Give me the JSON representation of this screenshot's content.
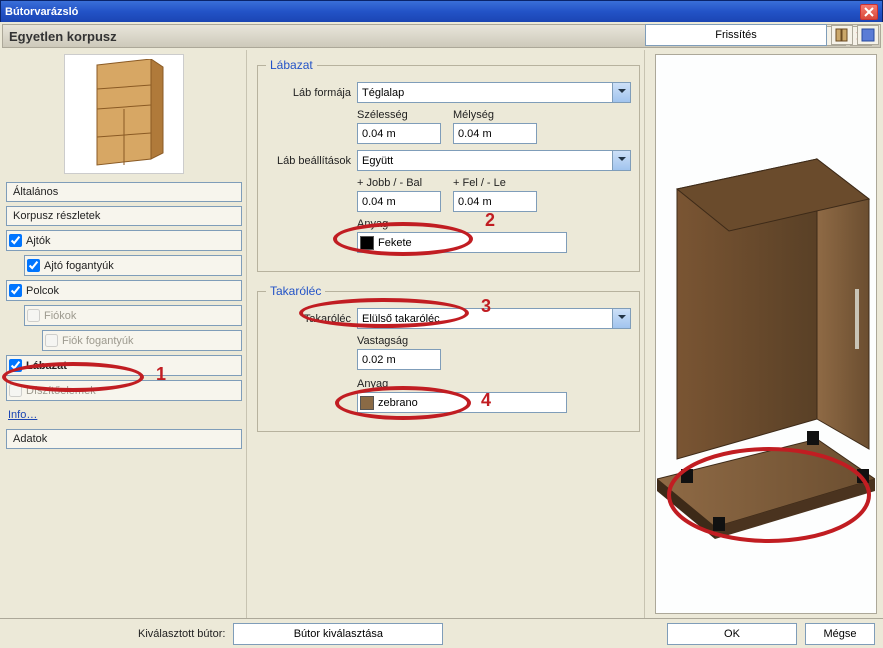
{
  "window": {
    "title": "Bútorvarázsló"
  },
  "subheader": {
    "title": "Egyetlen korpusz"
  },
  "refresh": {
    "label": "Frissítés"
  },
  "sidebar": {
    "items": [
      {
        "label": "Általános",
        "checked": null,
        "indent": 0,
        "disabled": false,
        "selected": false
      },
      {
        "label": "Korpusz részletek",
        "checked": null,
        "indent": 0,
        "disabled": false,
        "selected": false
      },
      {
        "label": "Ajtók",
        "checked": true,
        "indent": 0,
        "disabled": false,
        "selected": false
      },
      {
        "label": "Ajtó fogantyúk",
        "checked": true,
        "indent": 1,
        "disabled": false,
        "selected": false
      },
      {
        "label": "Polcok",
        "checked": true,
        "indent": 0,
        "disabled": false,
        "selected": false
      },
      {
        "label": "Fiókok",
        "checked": false,
        "indent": 1,
        "disabled": true,
        "selected": false
      },
      {
        "label": "Fiók fogantyúk",
        "checked": false,
        "indent": 2,
        "disabled": true,
        "selected": false
      },
      {
        "label": "Lábazat",
        "checked": true,
        "indent": 0,
        "disabled": false,
        "selected": true
      },
      {
        "label": "Díszítőelemek",
        "checked": false,
        "indent": 0,
        "disabled": true,
        "selected": false
      }
    ],
    "info_link": "Info…",
    "adatok": "Adatok"
  },
  "labazat": {
    "legend": "Lábazat",
    "leg_shape_label": "Láb formája",
    "leg_shape_value": "Téglalap",
    "width_label": "Szélesség",
    "depth_label": "Mélység",
    "width_value": "0.04 m",
    "depth_value": "0.04 m",
    "leg_settings_label": "Láb beállítások",
    "leg_settings_value": "Együtt",
    "jobb_label": "+ Jobb / - Bal",
    "fel_label": "+ Fel / - Le",
    "jobb_value": "0.04 m",
    "fel_value": "0.04 m",
    "mat_label": "Anyag",
    "mat_value": "Fekete",
    "mat_color": "#000000"
  },
  "takarolec": {
    "legend": "Takaróléc",
    "takarolec_label": "Takaróléc",
    "takarolec_value": "Elülső takaróléc",
    "thickness_label": "Vastagság",
    "thickness_value": "0.02 m",
    "mat_label": "Anyag",
    "mat_value": "zebrano",
    "mat_color": "#8a6a45"
  },
  "footer": {
    "selected_label": "Kiválasztott bútor:",
    "select_btn": "Bútor kiválasztása",
    "ok": "OK",
    "cancel": "Mégse"
  },
  "ann": {
    "n1": "1",
    "n2": "2",
    "n3": "3",
    "n4": "4"
  }
}
